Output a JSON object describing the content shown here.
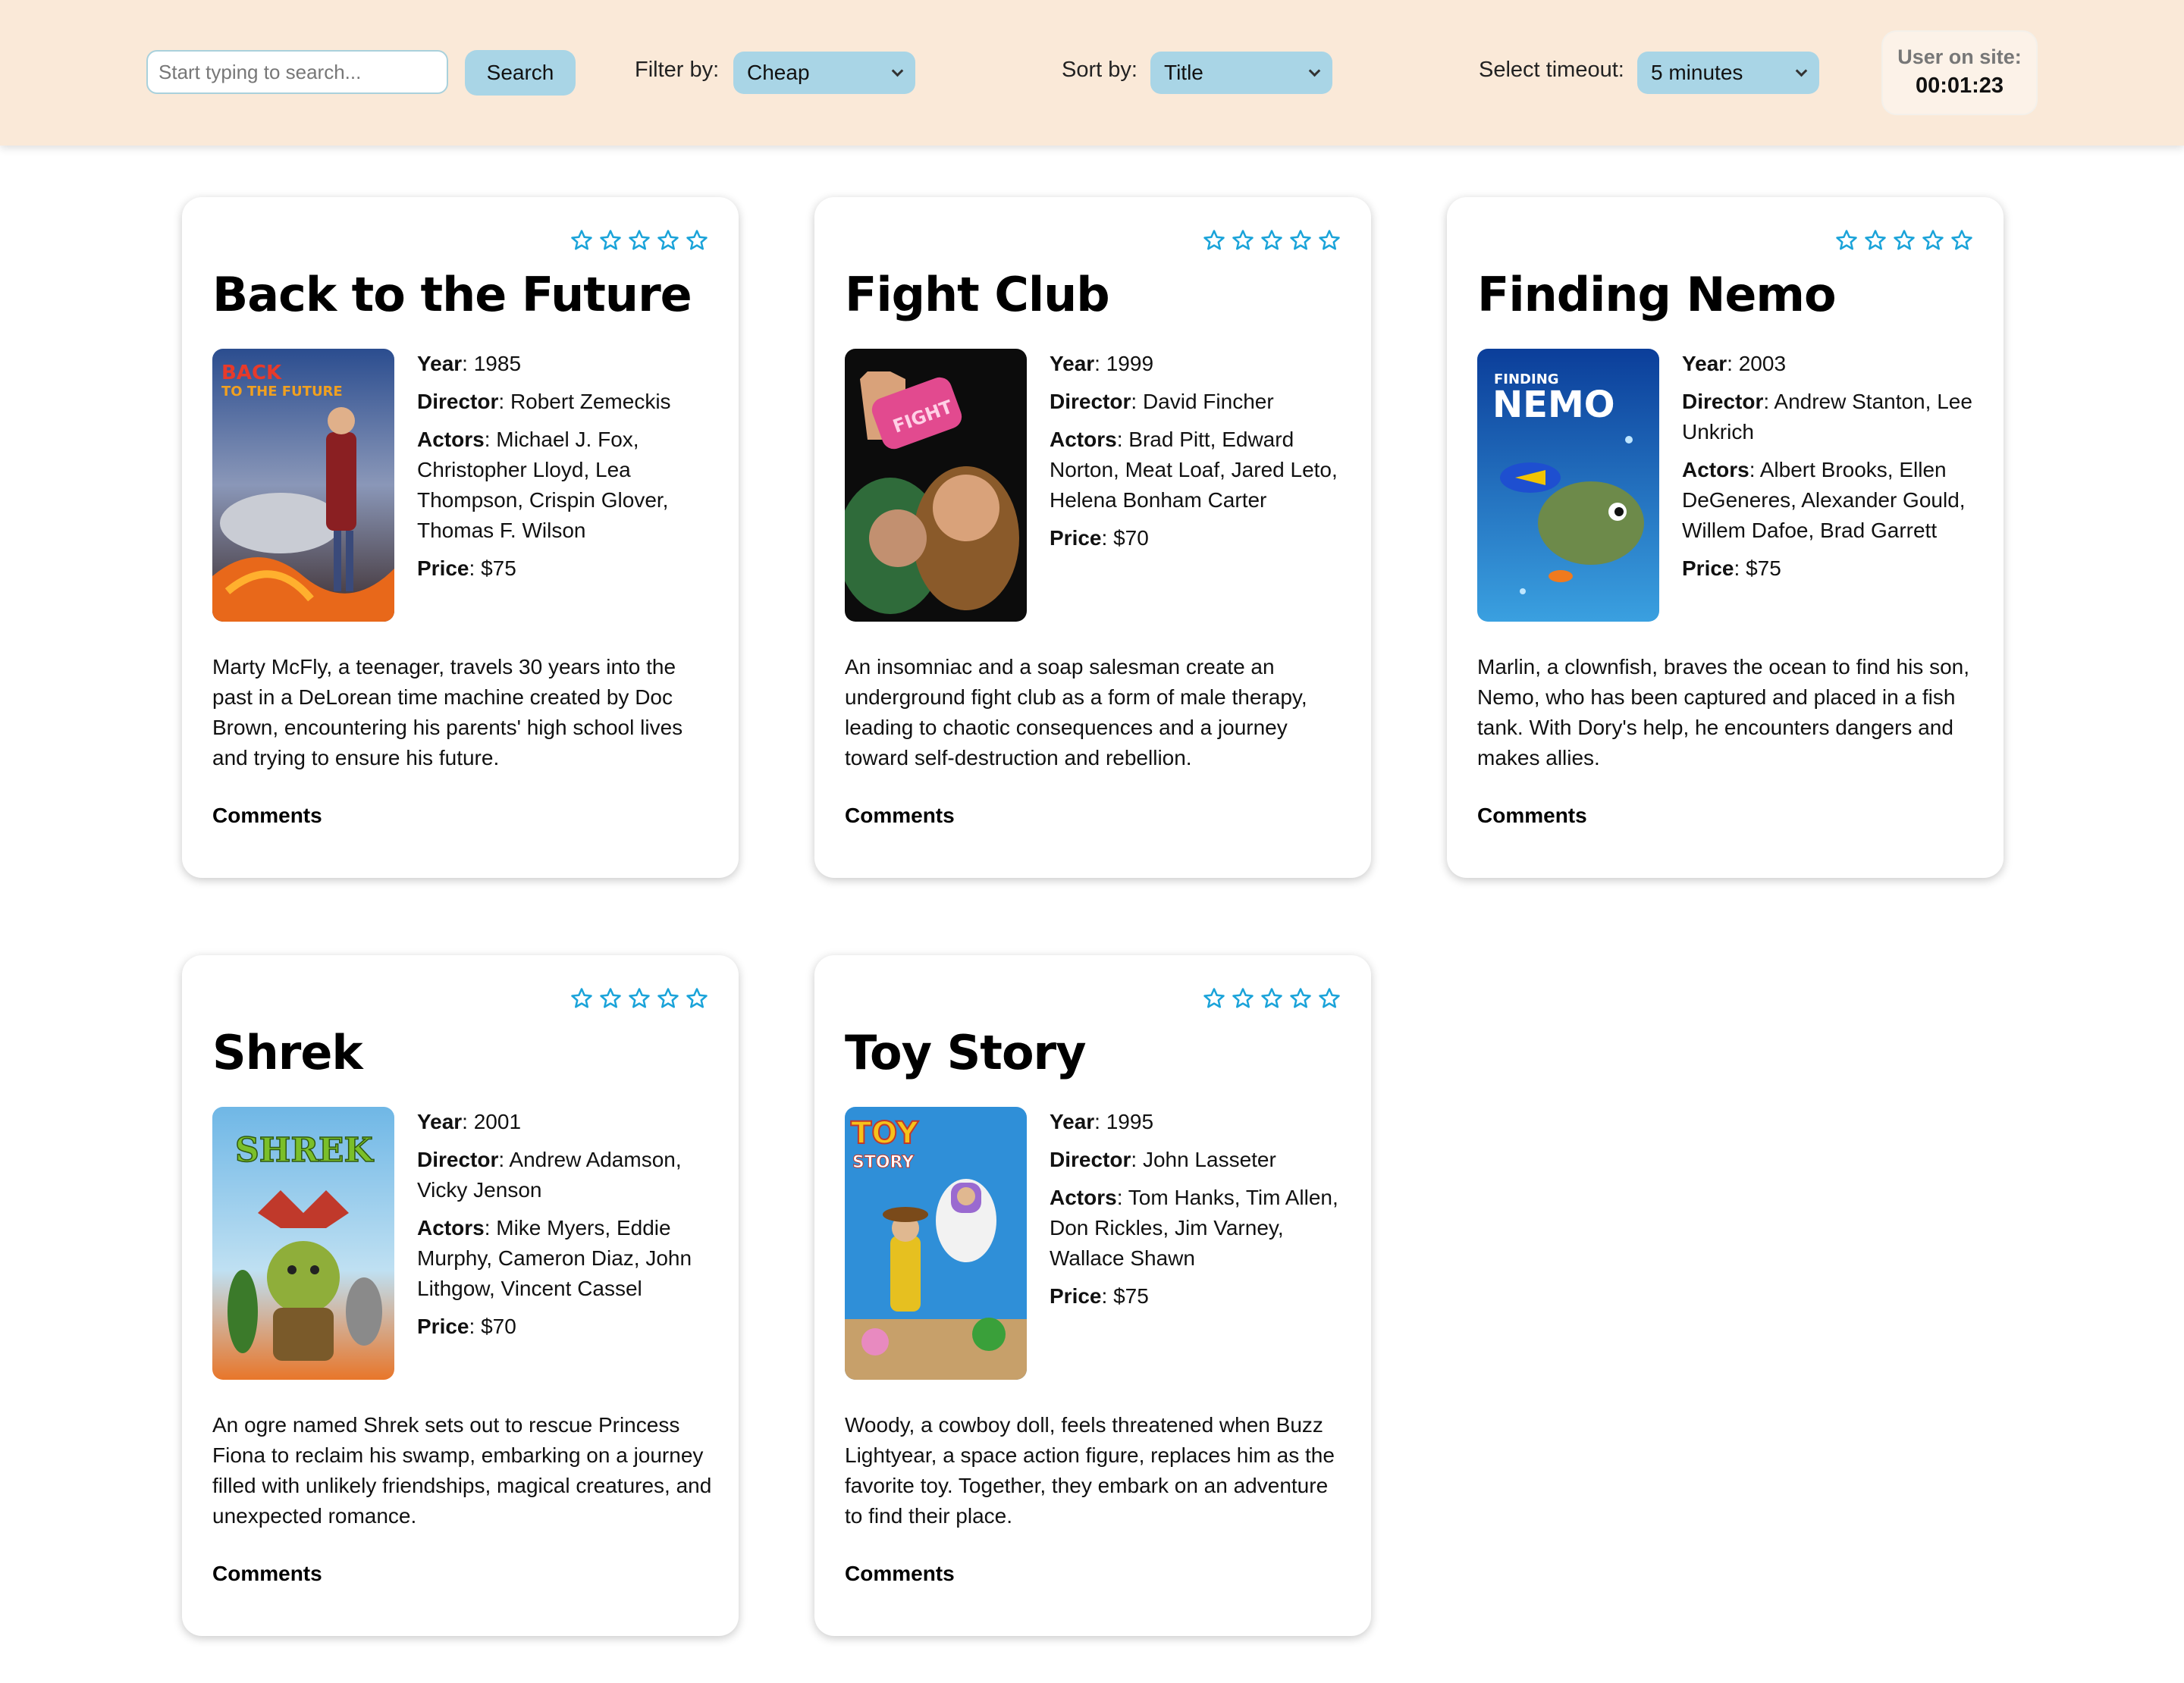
{
  "header": {
    "search_placeholder": "Start typing to search...",
    "search_button": "Search",
    "filter_label": "Filter by:",
    "filter_value": "Cheap",
    "sort_label": "Sort by:",
    "sort_value": "Title",
    "timeout_label": "Select timeout:",
    "timeout_value": "5 minutes",
    "timer_label": "User on site:",
    "timer_value": "00:01:23"
  },
  "colors": {
    "header_bg": "#fae9d8",
    "control_bg": "#a9d5e6",
    "star": "#1aa3d9"
  },
  "labels": {
    "year": "Year",
    "director": "Director",
    "actors": "Actors",
    "price": "Price",
    "comments": "Comments"
  },
  "rating_icon": "star-outline-icon",
  "movies": [
    {
      "title": "Back to the Future",
      "year": "1985",
      "director": "Robert Zemeckis",
      "actors": "Michael J. Fox, Christopher Lloyd, Lea Thompson, Crispin Glover, Thomas F. Wilson",
      "price": "$75",
      "description": "Marty McFly, a teenager, travels 30 years into the past in a DeLorean time machine created by Doc Brown, encountering his parents' high school lives and trying to ensure his future.",
      "poster_text": "BACK TO THE FUTURE"
    },
    {
      "title": "Fight Club",
      "year": "1999",
      "director": "David Fincher",
      "actors": "Brad Pitt, Edward Norton, Meat Loaf, Jared Leto, Helena Bonham Carter",
      "price": "$70",
      "description": "An insomniac and a soap salesman create an underground fight club as a form of male therapy, leading to chaotic consequences and a journey toward self-destruction and rebellion.",
      "poster_text": "FIGHT CLUB"
    },
    {
      "title": "Finding Nemo",
      "year": "2003",
      "director": "Andrew Stanton, Lee Unkrich",
      "actors": "Albert Brooks, Ellen DeGeneres, Alexander Gould, Willem Dafoe, Brad Garrett",
      "price": "$75",
      "description": "Marlin, a clownfish, braves the ocean to find his son, Nemo, who has been captured and placed in a fish tank. With Dory's help, he encounters dangers and makes allies.",
      "poster_text": "FINDING NEMO"
    },
    {
      "title": "Shrek",
      "year": "2001",
      "director": "Andrew Adamson, Vicky Jenson",
      "actors": "Mike Myers, Eddie Murphy, Cameron Diaz, John Lithgow, Vincent Cassel",
      "price": "$70",
      "description": "An ogre named Shrek sets out to rescue Princess Fiona to reclaim his swamp, embarking on a journey filled with unlikely friendships, magical creatures, and unexpected romance.",
      "poster_text": "SHREK"
    },
    {
      "title": "Toy Story",
      "year": "1995",
      "director": "John Lasseter",
      "actors": "Tom Hanks, Tim Allen, Don Rickles, Jim Varney, Wallace Shawn",
      "price": "$75",
      "description": "Woody, a cowboy doll, feels threatened when Buzz Lightyear, a space action figure, replaces him as the favorite toy. Together, they embark on an adventure to find their place.",
      "poster_text": "TOY STORY"
    }
  ]
}
